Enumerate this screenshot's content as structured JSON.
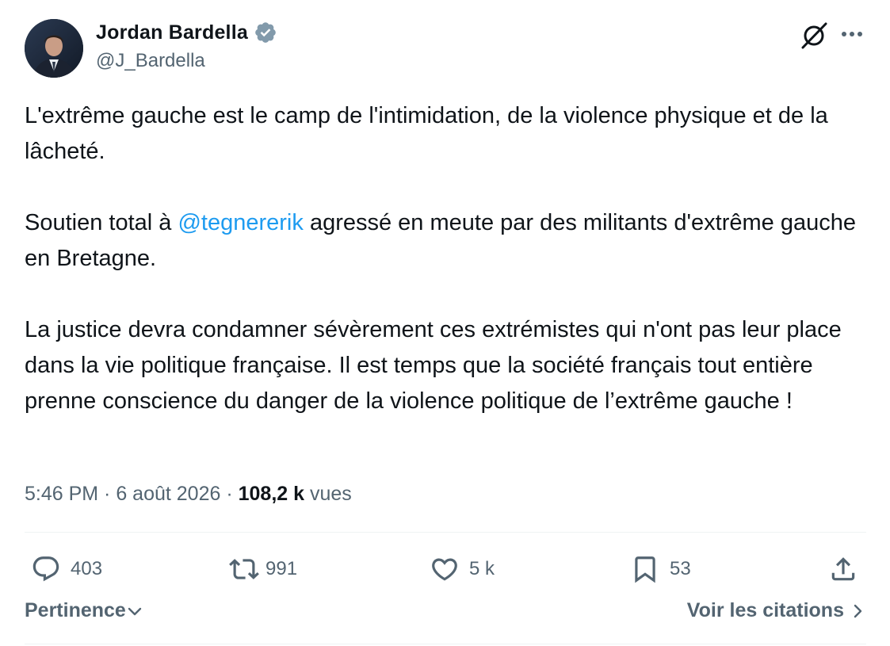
{
  "author": {
    "display_name": "Jordan Bardella",
    "handle": "@J_Bardella",
    "verified": true
  },
  "tweet": {
    "paragraphs": [
      {
        "text": "L'extrême gauche est le camp de l'intimidation, de la violence physique et de la lâcheté."
      },
      {
        "before": "Soutien total à ",
        "mention": "@tegnererik",
        "after": " agressé en meute par des militants d'extrême gauche en Bretagne."
      },
      {
        "text": "La justice devra condamner sévèrement ces extrémistes qui n'ont pas leur place dans la vie politique française. Il est temps que la société français tout entière prenne conscience du danger de la violence politique de l’extrême gauche !"
      }
    ]
  },
  "meta": {
    "time": "5:46 PM",
    "separator": " · ",
    "date": "6 août 2026",
    "views_count": "108,2 k",
    "views_label": " vues"
  },
  "actions": {
    "replies": "403",
    "reposts": "991",
    "likes": "5 k",
    "bookmarks": "53"
  },
  "footer": {
    "sort_label": "Pertinence",
    "quotes_label": "Voir les citations"
  },
  "icons": [
    "grok-icon",
    "more-icon",
    "verified-badge-icon",
    "reply-icon",
    "repost-icon",
    "like-icon",
    "bookmark-icon",
    "share-icon",
    "chevron-down-icon",
    "chevron-right-icon"
  ],
  "colors": {
    "text": "#0f1419",
    "secondary": "#536471",
    "link": "#1d9bf0",
    "divider": "#eff3f4",
    "verified_badge": "#829aab"
  }
}
